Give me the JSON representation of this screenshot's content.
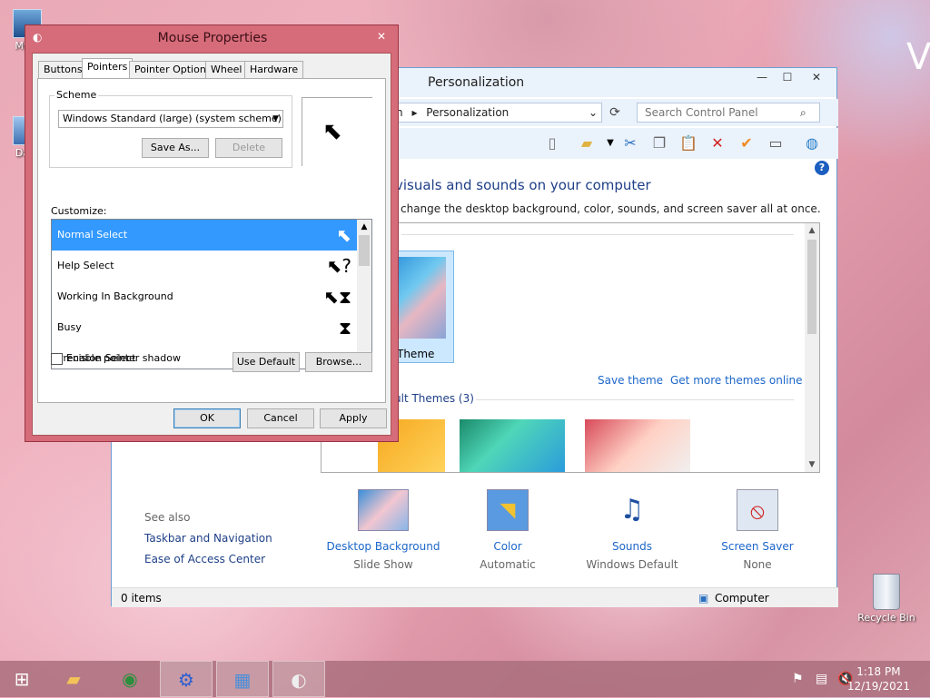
{
  "desktop": {
    "icons": [
      {
        "label": "My C"
      },
      {
        "label": "Data"
      },
      {
        "label": "Recycle Bin"
      }
    ],
    "watermark": "V"
  },
  "personalization": {
    "title": "Personalization",
    "breadcrumb_prefix": "n",
    "breadcrumb": "Personalization",
    "search_placeholder": "Search Control Panel",
    "heading": "visuals and sounds on your computer",
    "subtext": "change the desktop background, color, sounds, and screen saver all at once.",
    "theme_group_label": ")",
    "selected_theme_label": "Theme",
    "save_theme": "Save theme",
    "get_more_themes": "Get more themes online",
    "default_themes_label": "ult Themes (3)",
    "see_also": "See also",
    "see_also_links": [
      "Taskbar and Navigation",
      "Ease of Access Center"
    ],
    "bottom_items": [
      {
        "label": "Desktop Background",
        "value": "Slide Show"
      },
      {
        "label": "Color",
        "value": "Automatic"
      },
      {
        "label": "Sounds",
        "value": "Windows Default"
      },
      {
        "label": "Screen Saver",
        "value": "None"
      }
    ],
    "status_left": "0 items",
    "status_right": "Computer"
  },
  "mouse_properties": {
    "title": "Mouse Properties",
    "tabs": [
      "Buttons",
      "Pointers",
      "Pointer Options",
      "Wheel",
      "Hardware"
    ],
    "active_tab": "Pointers",
    "scheme_label": "Scheme",
    "scheme_value": "Windows Standard (large) (system scheme)",
    "save_as": "Save As...",
    "delete": "Delete",
    "customize_label": "Customize:",
    "pointers": [
      {
        "name": "Normal Select",
        "glyph": "⬉"
      },
      {
        "name": "Help Select",
        "glyph": "⬉?"
      },
      {
        "name": "Working In Background",
        "glyph": "⬉⧗"
      },
      {
        "name": "Busy",
        "glyph": "⧗"
      },
      {
        "name": "Precision Select",
        "glyph": "+"
      }
    ],
    "enable_shadow": "Enable pointer shadow",
    "use_default": "Use Default",
    "browse": "Browse...",
    "ok": "OK",
    "cancel": "Cancel",
    "apply": "Apply"
  },
  "taskbar": {
    "time": "1:18 PM",
    "date": "12/19/2021"
  }
}
